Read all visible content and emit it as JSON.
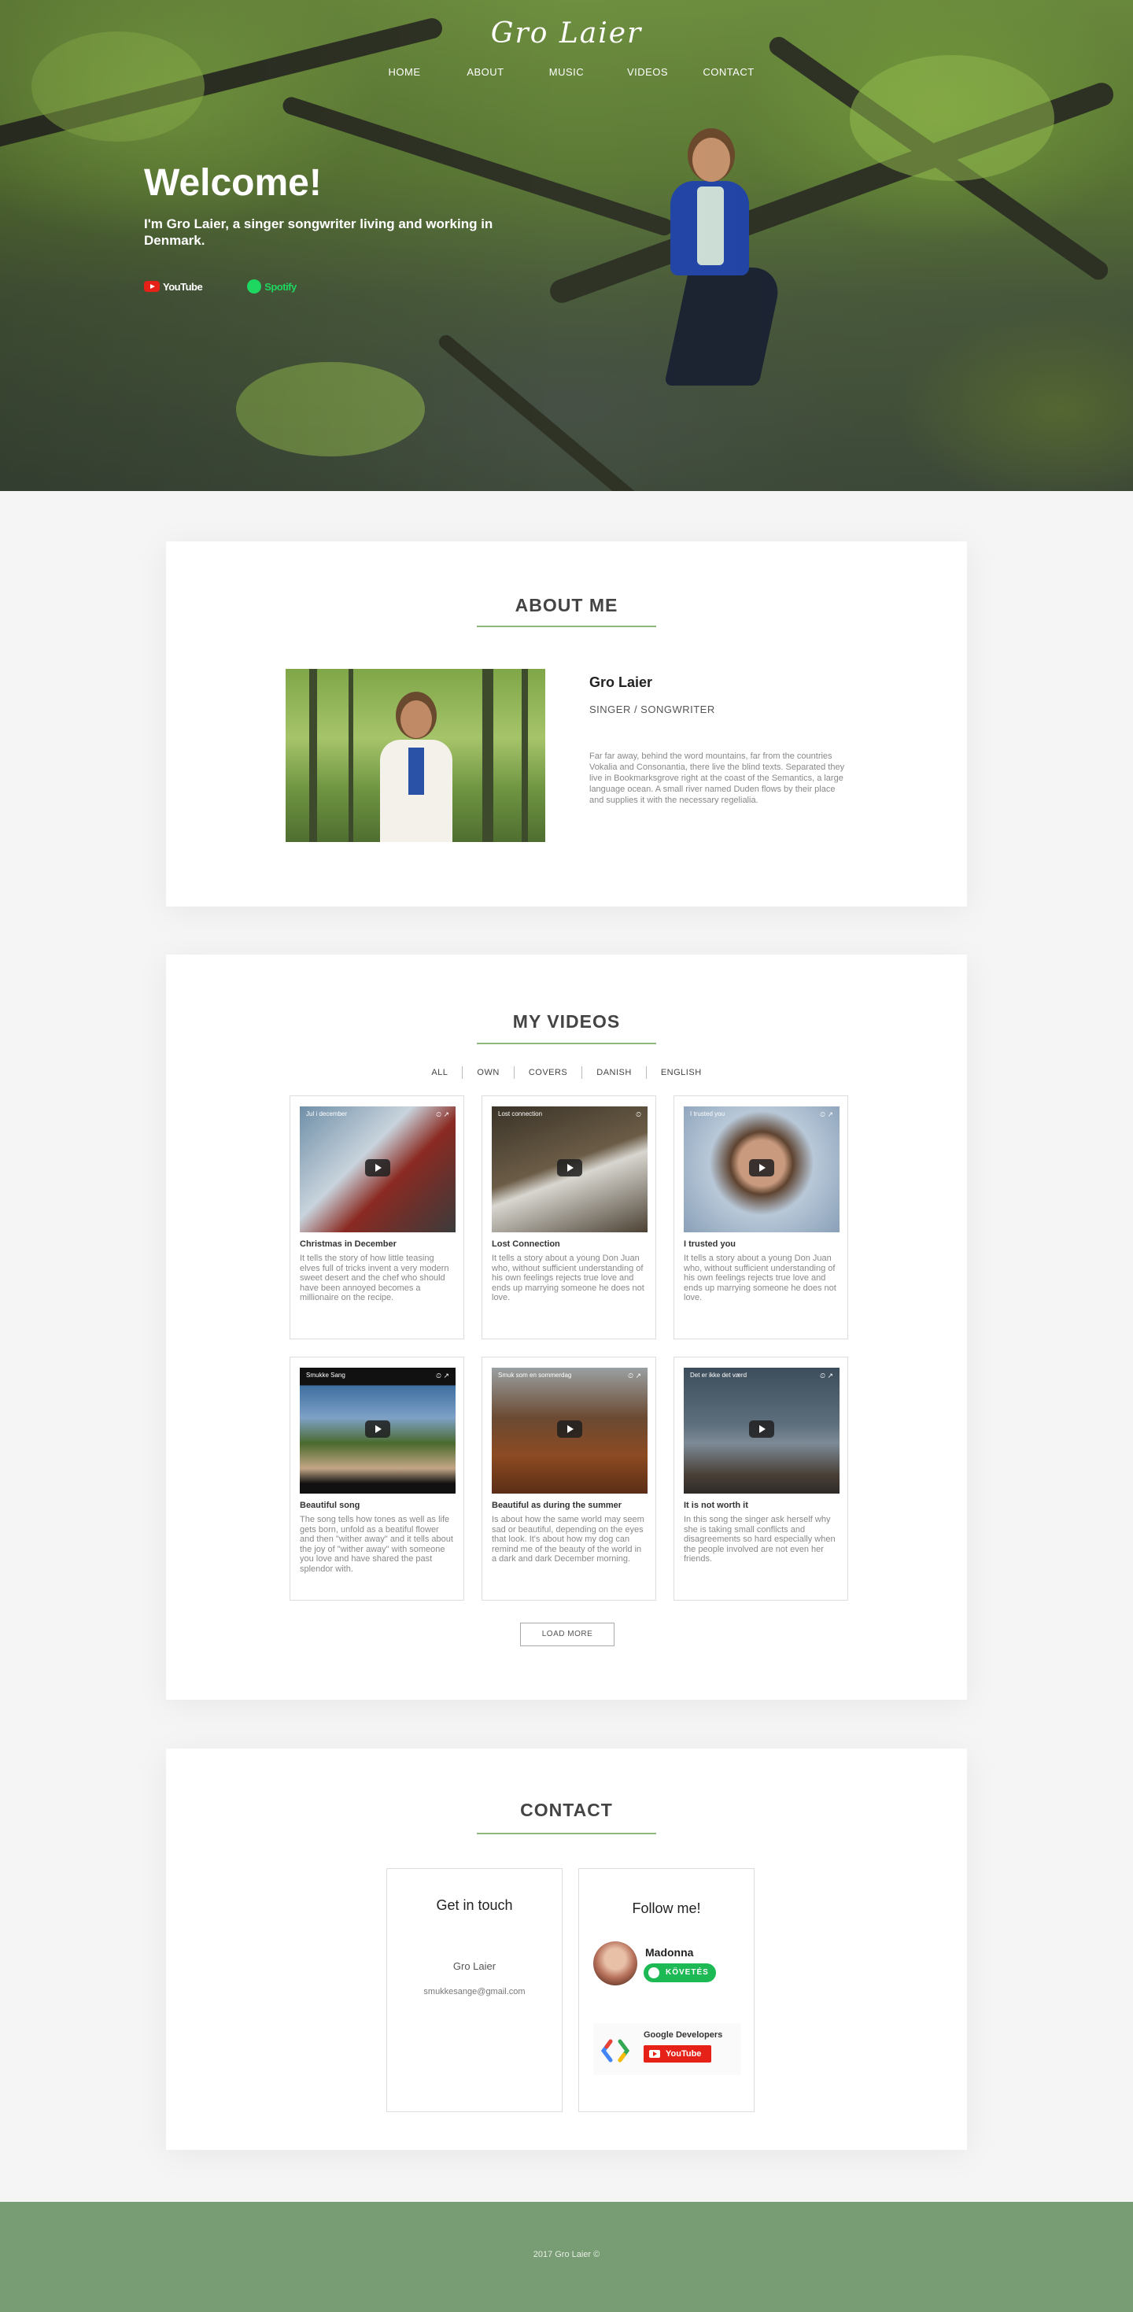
{
  "brand": {
    "name": "Gro Laier"
  },
  "nav": {
    "home": "HOME",
    "about": "ABOUT",
    "music": "MUSIC",
    "videos": "VIDEOS",
    "contact": "CONTACT"
  },
  "hero": {
    "title": "Welcome!",
    "subtitle": "I'm Gro Laier, a singer songwriter living and working in Denmark.",
    "youtube_label": "YouTube",
    "spotify_label": "Spotify"
  },
  "about": {
    "heading": "ABOUT ME",
    "name": "Gro Laier",
    "role": "SINGER / SONGWRITER",
    "text": "Far far away, behind the word mountains, far from the countries Vokalia and Consonantia, there live the blind texts. Separated they live in Bookmarksgrove right at the coast of the Semantics, a large language ocean. A small river named Duden flows by their place and supplies it with the necessary regelialia."
  },
  "videos": {
    "heading": "MY VIDEOS",
    "filters": [
      "ALL",
      "OWN",
      "COVERS",
      "DANISH",
      "ENGLISH"
    ],
    "items": [
      {
        "thumb_title": "Jul i december",
        "title": "Christmas in December",
        "desc": "It tells the story of how little teasing elves full of tricks invent a very modern sweet desert and the chef who should have been annoyed becomes a millionaire on the recipe."
      },
      {
        "thumb_title": "Lost connection",
        "title": "Lost Connection",
        "desc": "It tells a story about a young Don Juan who, without sufficient understanding of his own feelings rejects true love and ends up marrying someone he does not love."
      },
      {
        "thumb_title": "I trusted you",
        "title": "I trusted you",
        "desc": "It tells a story about a young Don Juan who, without sufficient understanding of his own feelings rejects true love and ends up marrying someone he does not love."
      },
      {
        "thumb_title": "Smukke Sang",
        "title": "Beautiful song",
        "desc": "The song tells how tones as well as life gets born, unfold as a beatiful flower and then \"wither away\" and it tells about the joy of \"wither away\" with someone you love and have shared the past splendor with."
      },
      {
        "thumb_title": "Smuk som en sommerdag",
        "title": "Beautiful as during the summer",
        "desc": "Is about how the same world may seem sad or beautiful, depending on the eyes that look. It's about how my dog can remind me of the beauty of the world in a dark and dark December morning."
      },
      {
        "thumb_title": "Det er ikke det værd",
        "title": "It is not worth it",
        "desc": "In this song the singer ask herself why she is taking small conflicts and disagreements so hard especially when the people involved are not even her friends."
      }
    ],
    "load_more": "LOAD MORE"
  },
  "contact": {
    "heading": "CONTACT",
    "touch_heading": "Get in touch",
    "name": "Gro Laier",
    "email": "smukkesange@gmail.com",
    "follow_heading": "Follow me!",
    "spotify_artist": "Madonna",
    "spotify_follow": "KÖVETÉS",
    "yt_channel": "Google Developers",
    "yt_button": "YouTube"
  },
  "footer": {
    "copyright": "2017 Gro Laier ©"
  },
  "colors": {
    "accent": "#8fb77e",
    "footer": "#789c73",
    "spotify": "#1db954",
    "youtube": "#e62117"
  }
}
